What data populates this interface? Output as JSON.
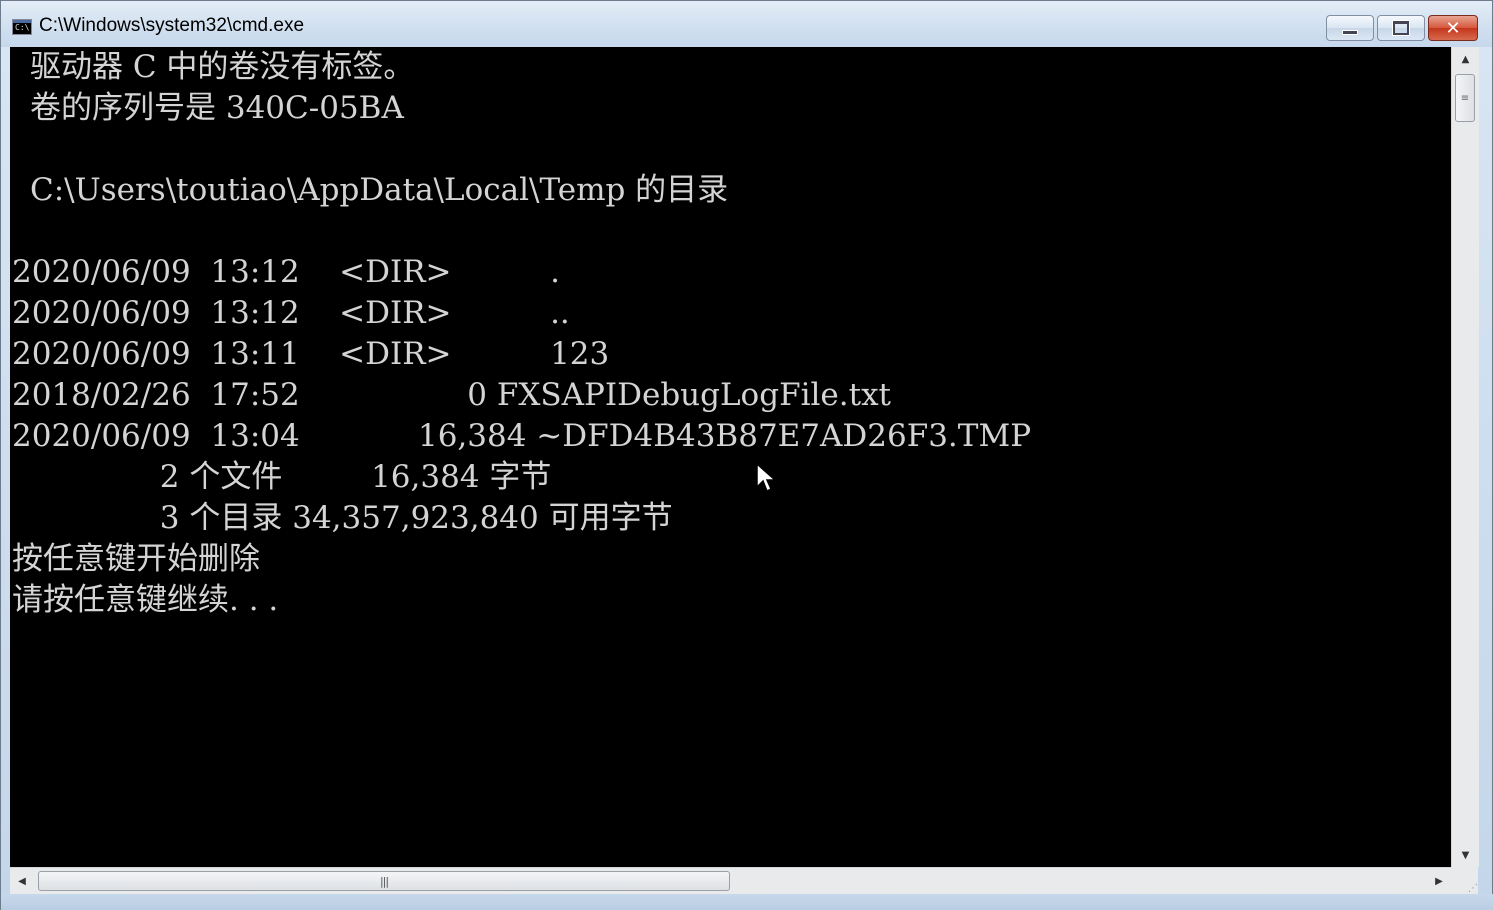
{
  "window": {
    "title": "C:\\Windows\\system32\\cmd.exe",
    "icon": "cmd-icon",
    "icon_text": "C:\\",
    "buttons": {
      "minimize": "minimize-icon",
      "maximize": "maximize-icon",
      "close": "✕"
    }
  },
  "console": {
    "lines": [
      "驱动器 C 中的卷没有标签。",
      "卷的序列号是 340C-05BA",
      "",
      "C:\\Users\\toutiao\\AppData\\Local\\Temp 的目录",
      "",
      "2020/06/09  13:12    <DIR>          .",
      "2020/06/09  13:12    <DIR>          ..",
      "2020/06/09  13:11    <DIR>          123",
      "2018/02/26  17:52                 0 FXSAPIDebugLogFile.txt",
      "2020/06/09  13:04            16,384 ~DFD4B43B87E7AD26F3.TMP",
      "               2 个文件         16,384 字节",
      "               3 个目录 34,357,923,840 可用字节",
      "按任意键开始删除",
      "请按任意键继续. . ."
    ]
  },
  "scrollbars": {
    "vertical": {
      "up": "▲",
      "down": "▼",
      "grip": "≡"
    },
    "horizontal": {
      "left": "◀",
      "right": "▶",
      "grip": "|||"
    }
  },
  "colors": {
    "console_bg": "#000000",
    "console_fg": "#d4d4d4",
    "close_button": "#c3361c"
  }
}
